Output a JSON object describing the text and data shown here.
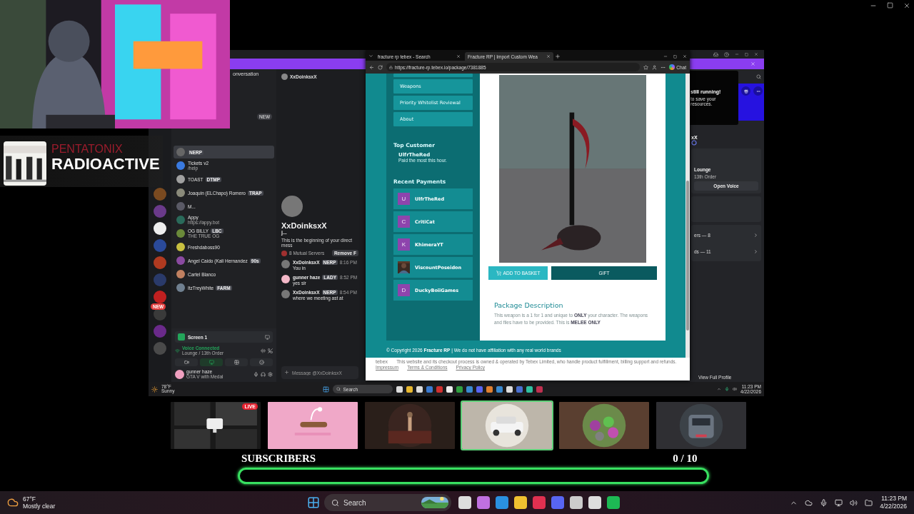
{
  "now_playing": {
    "artist": "PENTATONIX",
    "title": "RADIOACTIVE"
  },
  "discord": {
    "search_hint": "onversation",
    "new_badge": "NEW",
    "new_tag": "NEW",
    "dms": [
      {
        "tag": "NERP",
        "selected": true
      },
      {
        "name": "Tickets v2",
        "status": "/help",
        "selected": false
      },
      {
        "name": "TOAST",
        "tag": "DTMP",
        "selected": false
      },
      {
        "name": "Joaquin (ELChapo) Romero",
        "tag": "TRAP",
        "selected": false
      },
      {
        "name": "M...",
        "selected": false
      },
      {
        "name": "Appy",
        "status": "https://appy.bot",
        "selected": false
      },
      {
        "name": "OG BILLY",
        "tag": "LBC",
        "status": "THE TRUE OG",
        "selected": false
      },
      {
        "name": "Freshdaboss90",
        "selected": false
      },
      {
        "name": "Angel Caido (Kali Hernandez",
        "tag": "90s",
        "selected": false
      },
      {
        "name": "Cartel Blanco",
        "selected": false
      },
      {
        "name": "ItzTreyWhite",
        "tag": "FARM",
        "selected": false
      }
    ],
    "stream": {
      "title": "Screen 1"
    },
    "voice": {
      "status": "Voice Connected",
      "channel": "Lounge / 13th Order"
    },
    "user": {
      "name": "gunner haze",
      "activity": "GTA V with Medal"
    },
    "chat": {
      "recipient": "XxDoinksxX",
      "display_name": "XxDoinksxX",
      "username": "j...",
      "intro": "This is the beginning of your direct mess",
      "mutual": "8 Mutual Servers",
      "remove_button": "Remove F",
      "messages": [
        {
          "author": "XxDoinksxX",
          "tag": "NERP",
          "time": "8:16 PM",
          "text": "You in"
        },
        {
          "author": "gunner haze",
          "tag": "LADY",
          "time": "8:52 PM",
          "text": "yes sir"
        },
        {
          "author": "XxDoinksxX",
          "tag": "NERP",
          "time": "8:54 PM",
          "text": "where we meeting ast at"
        }
      ],
      "placeholder": "Message @XxDoinksxX"
    },
    "profile": {
      "notice_title": "still running!",
      "notice_body": "to save your resources.",
      "name": "xX",
      "activity_title": "Lounge",
      "activity_sub": "13th Order",
      "open_voice": "Open Voice",
      "links": [
        "ers — 8",
        "ds — 11"
      ],
      "view_profile": "View Full Profile"
    }
  },
  "browser": {
    "tabs": [
      {
        "title": "fracture rp tebex - Search",
        "selected": false
      },
      {
        "title": "Fracture RP | Import Custom Wea",
        "selected": true
      }
    ],
    "url": "https://fracture-rp.tebex.io/package/7381885",
    "chat": "Chat",
    "nav": [
      "Weapons",
      "Priority Whitelist Reviewal",
      "About"
    ],
    "top_customer": {
      "heading": "Top Customer",
      "name": "UlfrTheRed",
      "note": "Paid the most this hour."
    },
    "recent": {
      "heading": "Recent Payments",
      "items": [
        {
          "kind": "letter",
          "initial": "U",
          "name": "UlfrTheRed"
        },
        {
          "kind": "letter",
          "initial": "C",
          "name": "CritiCat"
        },
        {
          "kind": "letter",
          "initial": "K",
          "name": "KhimeraYT"
        },
        {
          "name": "ViscountPoseidon"
        },
        {
          "kind": "letter",
          "initial": "D",
          "name": "DuckyBoiiGames"
        }
      ]
    },
    "add_button": "ADD TO BASKET",
    "gift_button": "GIFT",
    "desc_heading": "Package Description",
    "desc": "This weapon is a 1 for 1 and unique to **ONLY** your character. The weapons and files have to be provided. This is **MELEE ONLY**",
    "copyright": "© Copyright 2026 **Fracture RP** | We do not have affiliation with any real world brands",
    "tebex": "tebex",
    "legal": "This website and its checkout process is owned & operated by Tebex Limited, who handle product fulfillment, billing support and refunds.",
    "legal_links": [
      "Impressum",
      "Terms & Conditions",
      "Privacy Policy"
    ]
  },
  "inner_taskbar": {
    "temp": "78°F",
    "weather": "Sunny",
    "search": "Search",
    "time": "11:23 PM",
    "date": "4/22/2026"
  },
  "thumbnails": [
    {
      "kind": "picture",
      "live": "LIVE",
      "selected": false
    },
    {
      "kind": "picture",
      "selected": false
    },
    {
      "kind": "picture",
      "selected": false
    },
    {
      "kind": "picture",
      "selected": true
    },
    {
      "kind": "picture",
      "selected": false
    },
    {
      "kind": "picture",
      "selected": false
    }
  ],
  "subscribers": {
    "label": "SUBSCRIBERS",
    "count": "0 / 10",
    "level": 0
  },
  "taskbar": {
    "temp": "67°F",
    "weather": "Mostly clear",
    "search": "Search",
    "time": "11:23 PM",
    "date": "4/22/2026"
  }
}
